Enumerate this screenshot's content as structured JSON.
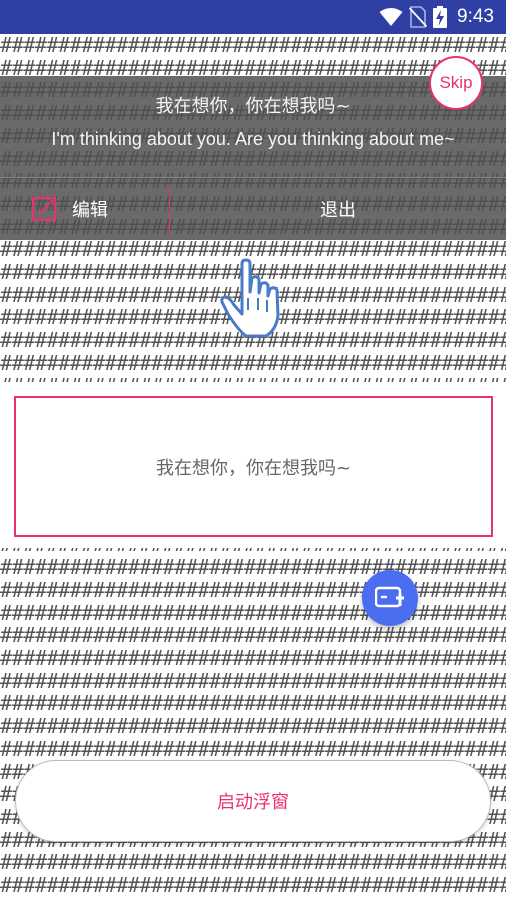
{
  "status_bar": {
    "time": "9:43",
    "icons": [
      "wifi-icon",
      "no-sim-icon",
      "battery-charging-icon"
    ]
  },
  "background": {
    "glyph": "#"
  },
  "overlay": {
    "text_cn": "我在想你，你在想我吗~",
    "text_en": "I'm thinking about you. Are you thinking about me~",
    "edit_label": "编辑",
    "exit_label": "退出"
  },
  "skip": {
    "label": "Skip"
  },
  "content": {
    "text": "我在想你，你在想我吗~"
  },
  "launch_button": {
    "label": "启动浮窗"
  },
  "fab": {
    "icon": "add-window-icon"
  },
  "colors": {
    "accent": "#e8326d",
    "status_bar": "#2f3fa3",
    "fab": "#4b6ef0",
    "overlay": "#505050"
  }
}
